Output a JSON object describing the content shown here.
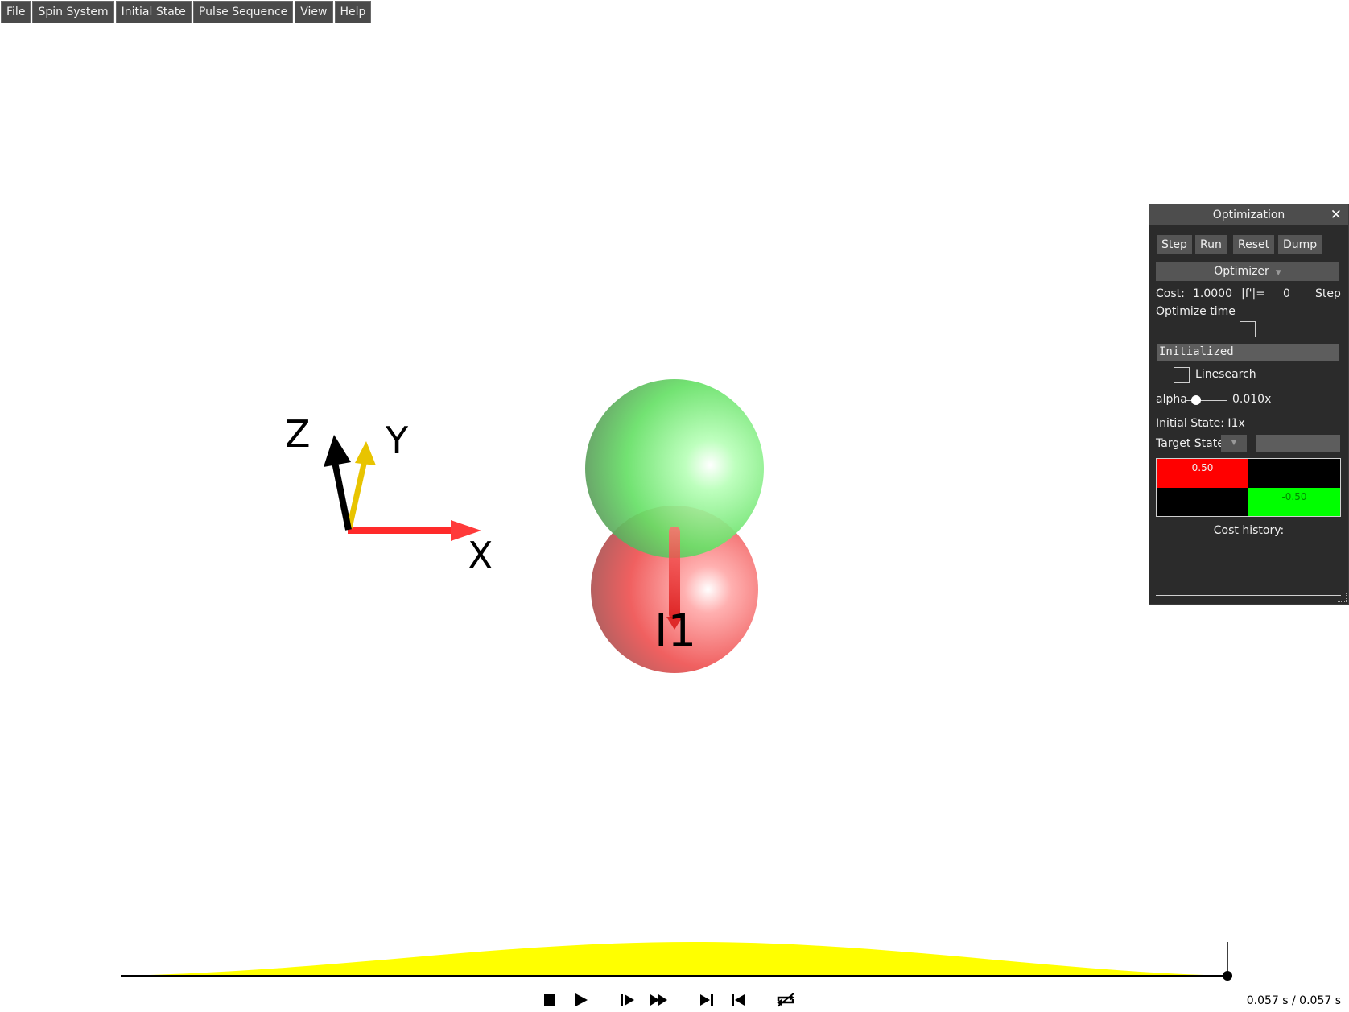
{
  "menu": [
    "File",
    "Spin System",
    "Initial State",
    "Pulse Sequence",
    "View",
    "Help"
  ],
  "scene": {
    "axes": {
      "x": "X",
      "y": "Y",
      "z": "Z"
    },
    "spin_label": "I1",
    "colors": {
      "x_axis": "#ff2a2a",
      "y_axis": "#e8c400",
      "z_axis": "#000000",
      "upper_sphere": "#5ce65c",
      "lower_sphere": "#ff6a6a"
    }
  },
  "optimization": {
    "title": "Optimization",
    "close": "✕",
    "buttons": {
      "step": "Step",
      "run": "Run",
      "reset": "Reset",
      "dump": "Dump"
    },
    "optimizer": "Optimizer",
    "cost_label": "Cost:",
    "cost_value": "1.0000",
    "grad_label": "|f'|=",
    "grad_value": "0",
    "step_label": "Step",
    "optimize_time": "Optimize time",
    "status": "Initialized",
    "linesearch": "Linesearch",
    "alpha_label": "alpha",
    "alpha_value": "0.010x",
    "initial_state": "Initial State: I1x",
    "target_state": "Target State:",
    "matrix": {
      "cells": [
        "0.50",
        "",
        "",
        "-0.50"
      ],
      "colors": [
        "#ff0000",
        "#000000",
        "#000000",
        "#00ff00"
      ]
    },
    "cost_history": "Cost history:"
  },
  "timeline": {
    "time": "0.057 s / 0.057 s",
    "pulse_color": "#ffff00"
  },
  "controls": [
    "stop",
    "play",
    "step-forward",
    "fast-forward",
    "skip-to-end",
    "skip-to-start",
    "loop"
  ]
}
